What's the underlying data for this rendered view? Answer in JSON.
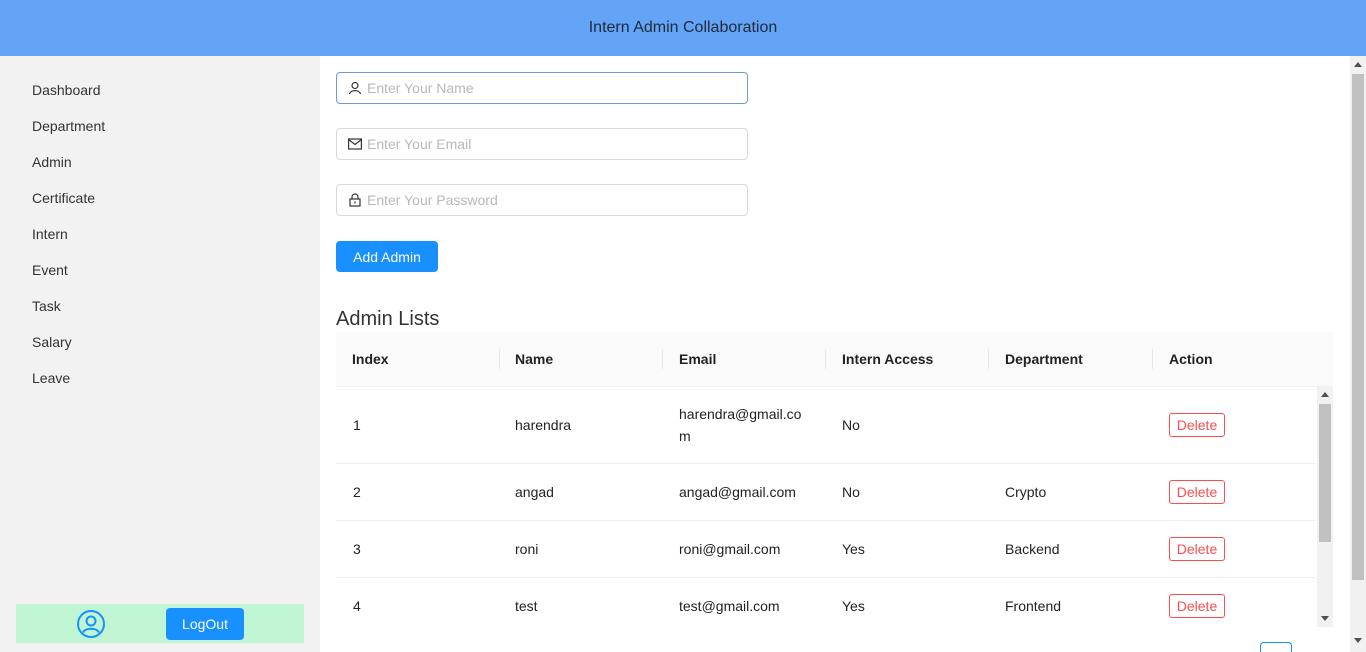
{
  "header": {
    "title": "Intern Admin Collaboration"
  },
  "sidebar": {
    "items": [
      {
        "label": "Dashboard"
      },
      {
        "label": "Department"
      },
      {
        "label": "Admin"
      },
      {
        "label": "Certificate"
      },
      {
        "label": "Intern"
      },
      {
        "label": "Event"
      },
      {
        "label": "Task"
      },
      {
        "label": "Salary"
      },
      {
        "label": "Leave"
      }
    ],
    "logout_label": "LogOut"
  },
  "form": {
    "name_placeholder": "Enter Your Name",
    "email_placeholder": "Enter Your Email",
    "password_placeholder": "Enter Your Password",
    "add_label": "Add Admin"
  },
  "admin_list": {
    "title": "Admin Lists",
    "columns": [
      "Index",
      "Name",
      "Email",
      "Intern Access",
      "Department",
      "Action"
    ],
    "rows": [
      {
        "index": "1",
        "name": "harendra",
        "email_line1": "harendra@gmail.co",
        "email_line2": "m",
        "access": "No",
        "department": "",
        "action": "Delete"
      },
      {
        "index": "2",
        "name": "angad",
        "email": "angad@gmail.com",
        "access": "No",
        "department": "Crypto",
        "action": "Delete"
      },
      {
        "index": "3",
        "name": "roni",
        "email": "roni@gmail.com",
        "access": "Yes",
        "department": "Backend",
        "action": "Delete"
      },
      {
        "index": "4",
        "name": "test",
        "email": "test@gmail.com",
        "access": "Yes",
        "department": "Frontend",
        "action": "Delete"
      }
    ]
  },
  "colors": {
    "header": "#63a4f6",
    "primary": "#1890ff",
    "danger": "#ff4d4f",
    "footer": "#bff5d3",
    "sidebar": "#f2f2f2"
  }
}
